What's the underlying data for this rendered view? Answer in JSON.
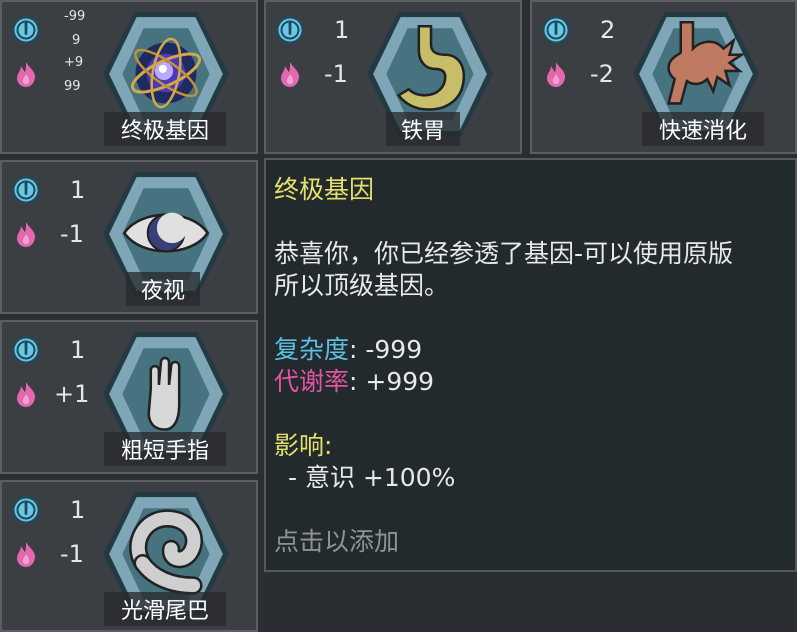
{
  "genes": [
    {
      "name": "终极基因",
      "complexity": "-999",
      "metabolism": "+999",
      "icon": "atom-orb-icon",
      "selected": true
    },
    {
      "name": "铁胃",
      "complexity": "1",
      "metabolism": "-1",
      "icon": "stomach-icon"
    },
    {
      "name": "快速消化",
      "complexity": "2",
      "metabolism": "-2",
      "icon": "digestive-tract-icon"
    },
    {
      "name": "夜视",
      "complexity": "1",
      "metabolism": "-1",
      "icon": "eye-icon"
    },
    {
      "name": "粗短手指",
      "complexity": "1",
      "metabolism": "+1",
      "icon": "stubby-hand-icon"
    },
    {
      "name": "光滑尾巴",
      "complexity": "1",
      "metabolism": "-1",
      "icon": "tail-icon"
    }
  ],
  "top_tile_stats": {
    "complexity_a": "-99",
    "complexity_b": "9",
    "metabolism_a": "+9",
    "metabolism_b": "99"
  },
  "detail": {
    "title": "终极基因",
    "description_line1": "恭喜你，你已经参透了基因-可以使用原版",
    "description_line2": "所以顶级基因。",
    "complexity_label": "复杂度",
    "complexity_value": ": -999",
    "metabolism_label": "代谢率",
    "metabolism_value": ": +999",
    "effects_label": "影响:",
    "effect_1": "- 意识 +100%",
    "add_prompt": "点击以添加"
  },
  "colors": {
    "complexity": "#5cc0e2",
    "metabolism": "#e054a2",
    "title": "#e5e06a",
    "hex_fill": "#7fa6b6",
    "hex_inner": "#46737f"
  }
}
